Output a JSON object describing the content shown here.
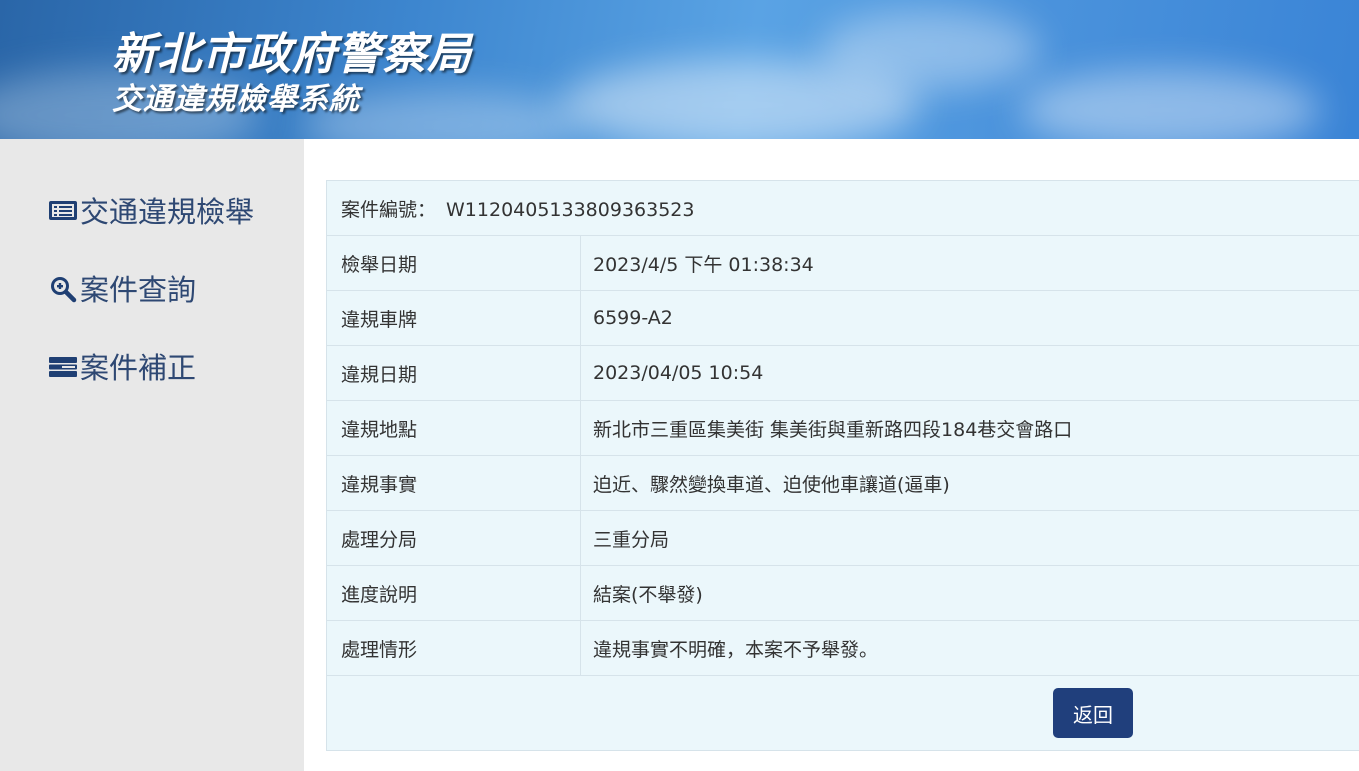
{
  "header": {
    "title": "新北市政府警察局",
    "subtitle": "交通違規檢舉系統"
  },
  "sidebar": {
    "items": [
      {
        "label": "交通違規檢舉",
        "icon": "list-icon"
      },
      {
        "label": "案件查詢",
        "icon": "search-plus-icon"
      },
      {
        "label": "案件補正",
        "icon": "edit-list-icon"
      }
    ]
  },
  "case": {
    "number_label": "案件編號：",
    "number": "W1120405133809363523",
    "fields": [
      {
        "label": "檢舉日期",
        "value": "2023/4/5 下午 01:38:34"
      },
      {
        "label": "違規車牌",
        "value": "6599-A2"
      },
      {
        "label": "違規日期",
        "value": "2023/04/05 10:54"
      },
      {
        "label": "違規地點",
        "value": "新北市三重區集美街 集美街與重新路四段184巷交會路口"
      },
      {
        "label": "違規事實",
        "value": "迫近、驟然變換車道、迫使他車讓道(逼車)"
      },
      {
        "label": "處理分局",
        "value": "三重分局"
      },
      {
        "label": "進度說明",
        "value": "結案(不舉發)"
      },
      {
        "label": "處理情形",
        "value": "違規事實不明確，本案不予舉發。"
      }
    ],
    "back_label": "返回"
  },
  "colors": {
    "nav_text": "#2e4873",
    "button_bg": "#203f7c",
    "table_bg": "#ebf7fb",
    "sidebar_bg": "#e8e8e8"
  }
}
